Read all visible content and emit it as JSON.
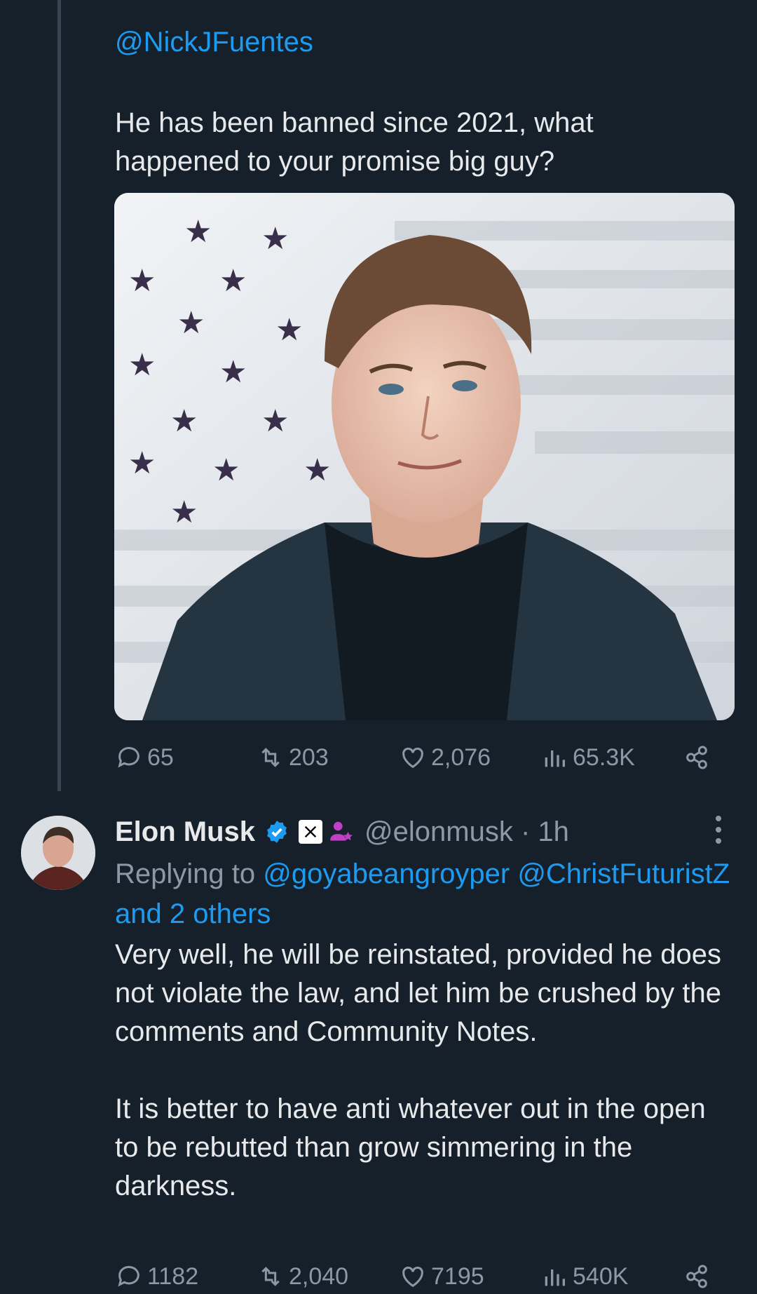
{
  "parent_tweet": {
    "mention": "@NickJFuentes",
    "text": "He has been banned since 2021, what happened to your promise big guy?",
    "image_description_icon": "photo-man-flag",
    "stats": {
      "replies": "65",
      "reposts": "203",
      "likes": "2,076",
      "views": "65.3K"
    }
  },
  "reply_tweet": {
    "author_name": "Elon Musk",
    "handle_time": "@elonmusk · 1h",
    "replying_prefix": "Replying to",
    "replying_users": "@goyabeangroyper @ChristFuturistZ and 2 others",
    "paragraph1": "Very well, he will be reinstated, provided he does not violate the law, and let him be crushed by the comments and Community Notes.",
    "paragraph2": "It is better to have anti whatever out in the open to be rebutted than grow simmering in the darkness.",
    "stats": {
      "replies": "1182",
      "reposts": "2,040",
      "likes": "7195",
      "views": "540K"
    }
  },
  "colors": {
    "background": "#16202b",
    "text": "#e7e9ea",
    "secondary": "#8b98a5",
    "link": "#1d9bf0",
    "verified": "#1d9bf0",
    "affiliate": "#c040c8"
  }
}
